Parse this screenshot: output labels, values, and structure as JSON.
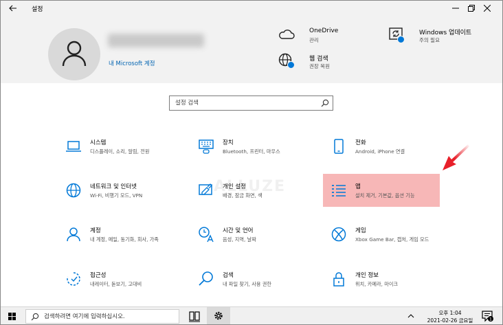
{
  "window": {
    "title": "설정",
    "icons": {
      "back": "back-arrow-icon",
      "minimize": "minimize-icon",
      "maximize": "restore-icon",
      "close": "close-icon"
    }
  },
  "header": {
    "account_link": "내 Microsoft 계정",
    "items": [
      {
        "title": "OneDrive",
        "subtitle": "관리",
        "icon": "cloud-icon"
      },
      {
        "title": "Windows 업데이트",
        "subtitle": "주의 필요",
        "icon": "update-icon"
      },
      {
        "title": "웹 검색",
        "subtitle": "권장 복원",
        "icon": "globe-icon"
      }
    ]
  },
  "search": {
    "placeholder": "설정 검색"
  },
  "tiles": [
    {
      "name": "시스템",
      "desc": "디스플레이, 소리, 알림, 전원",
      "icon": "laptop-icon"
    },
    {
      "name": "장치",
      "desc": "Bluetooth, 프린터, 마우스",
      "icon": "keyboard-icon"
    },
    {
      "name": "전화",
      "desc": "Android, iPhone 연결",
      "icon": "phone-icon"
    },
    {
      "name": "네트워크 및 인터넷",
      "desc": "Wi-Fi, 비행기 모드, VPN",
      "icon": "globe-icon"
    },
    {
      "name": "개인 설정",
      "desc": "배경, 잠금 화면, 색",
      "icon": "paint-icon"
    },
    {
      "name": "앱",
      "desc": "설치 제거, 기본값, 옵션 기능",
      "icon": "apps-list-icon"
    },
    {
      "name": "계정",
      "desc": "내 계정, 메일, 동기화, 회사, 가족",
      "icon": "person-icon"
    },
    {
      "name": "시간 및 언어",
      "desc": "음성, 지역, 날짜",
      "icon": "time-language-icon"
    },
    {
      "name": "게임",
      "desc": "Xbox Game Bar, 캡처, 게임 모드",
      "icon": "xbox-icon"
    },
    {
      "name": "접근성",
      "desc": "내레이터, 돋보기, 고대비",
      "icon": "accessibility-icon"
    },
    {
      "name": "검색",
      "desc": "내 파일 찾기, 사용 권한",
      "icon": "search-icon"
    },
    {
      "name": "개인 정보",
      "desc": "위치, 카메라, 마이크",
      "icon": "lock-icon"
    }
  ],
  "highlighted_tile": "앱",
  "watermark": "ALLUZE",
  "colors": {
    "accent": "#0078d7",
    "highlight": "#f7b7b7",
    "arrow": "#e8202a"
  },
  "taskbar": {
    "search_placeholder": "검색하려면 여기에 입력하십시오.",
    "time": "오후 1:04",
    "date": "2021-02-26 금요일",
    "notification_count": "1"
  }
}
